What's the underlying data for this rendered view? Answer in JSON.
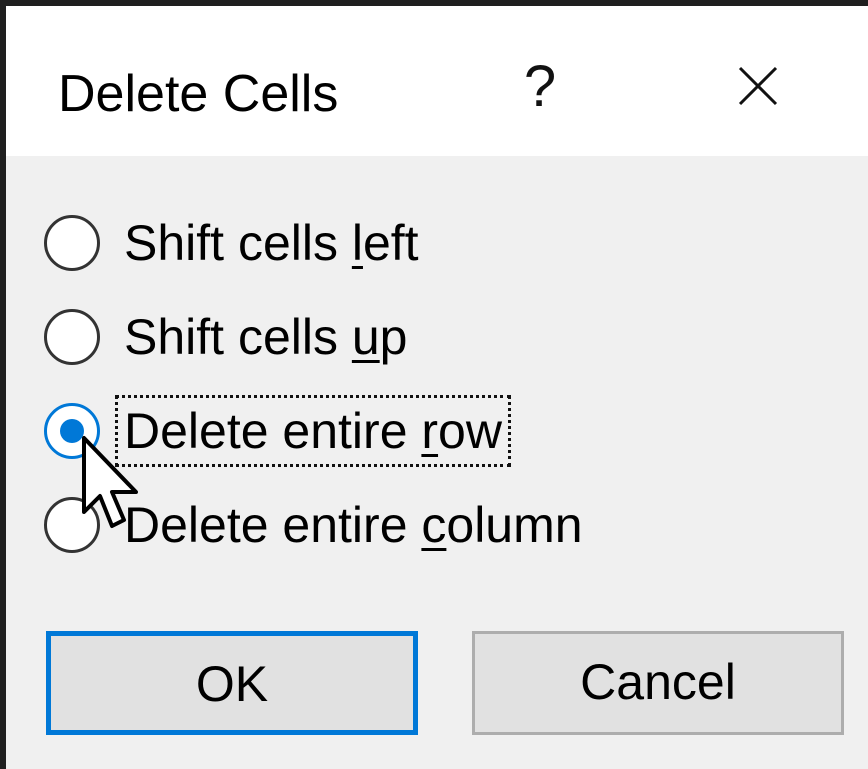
{
  "dialog": {
    "title": "Delete Cells",
    "help_label": "?",
    "close_icon": "close-icon"
  },
  "options": [
    {
      "pre": "Shift cells ",
      "key": "l",
      "post": "eft",
      "selected": false
    },
    {
      "pre": "Shift cells ",
      "key": "u",
      "post": "p",
      "selected": false
    },
    {
      "pre": "Delete entire ",
      "key": "r",
      "post": "ow",
      "selected": true
    },
    {
      "pre": "Delete entire ",
      "key": "c",
      "post": "olumn",
      "selected": false
    }
  ],
  "buttons": {
    "ok_label": "OK",
    "cancel_label": "Cancel"
  },
  "colors": {
    "accent": "#0078d7",
    "dialog_background": "#f0f0f0",
    "titlebar_background": "#ffffff"
  },
  "cursor_icon": "arrow-cursor-icon"
}
